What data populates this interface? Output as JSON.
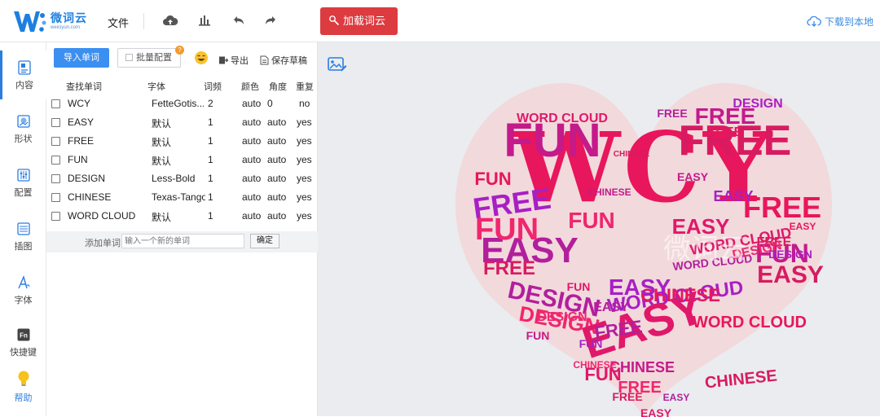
{
  "app": {
    "name": "微词云",
    "url": "weiciyun.com"
  },
  "toolbar": {
    "file_label": "文件",
    "icons": [
      "cloud-upload-icon",
      "bar-chart-icon",
      "undo-icon",
      "redo-icon"
    ],
    "load_button": "加载词云",
    "download_label": "下载到本地",
    "accent": "#dc3b40",
    "link_color": "#3b8be0"
  },
  "sidebar": {
    "items": [
      {
        "label": "内容",
        "icon": "content-icon",
        "active": true
      },
      {
        "label": "形状",
        "icon": "shape-icon"
      },
      {
        "label": "配置",
        "icon": "config-icon"
      },
      {
        "label": "插图",
        "icon": "illustration-icon"
      },
      {
        "label": "字体",
        "icon": "font-icon"
      },
      {
        "label": "快捷键",
        "icon": "shortcut-icon"
      },
      {
        "label": "帮助",
        "icon": "lightbulb-icon"
      }
    ]
  },
  "panel": {
    "import_button": "导入单词",
    "batch_button": "批量配置",
    "batch_badge": "?",
    "export_button": "导出",
    "save_button": "保存草稿",
    "columns": [
      "查找单词",
      "字体",
      "词频",
      "颜色",
      "角度",
      "重复"
    ],
    "rows": [
      {
        "word": "WCY",
        "font": "FetteGotis...",
        "freq": "2",
        "color": "auto",
        "angle": "0",
        "repeat": "no"
      },
      {
        "word": "EASY",
        "font": "默认",
        "freq": "1",
        "color": "auto",
        "angle": "auto",
        "repeat": "yes"
      },
      {
        "word": "FREE",
        "font": "默认",
        "freq": "1",
        "color": "auto",
        "angle": "auto",
        "repeat": "yes"
      },
      {
        "word": "FUN",
        "font": "默认",
        "freq": "1",
        "color": "auto",
        "angle": "auto",
        "repeat": "yes"
      },
      {
        "word": "DESIGN",
        "font": "Less-Bold",
        "freq": "1",
        "color": "auto",
        "angle": "auto",
        "repeat": "yes"
      },
      {
        "word": "CHINESE",
        "font": "Texas-Tango",
        "freq": "1",
        "color": "auto",
        "angle": "auto",
        "repeat": "yes"
      },
      {
        "word": "WORD CLOUD",
        "font": "默认",
        "freq": "1",
        "color": "auto",
        "angle": "auto",
        "repeat": "yes"
      }
    ],
    "add_label": "添加单词",
    "add_placeholder": "输入一个新的单词",
    "add_confirm": "确定"
  },
  "canvas": {
    "background": "#eaecef",
    "heart_fill": "#f2d9dc",
    "watermark": "微词云",
    "words": [
      "WCY",
      "FUN",
      "FREE",
      "EASY",
      "FUN",
      "FREE",
      "EASY",
      "FREE",
      "FUN",
      "EASY",
      "DESIGN",
      "DESIGN",
      "WORD CLOUD",
      "WORD CLOUD",
      "CHINESE",
      "CHINESE",
      "CHINESE",
      "FREE",
      "FUN",
      "EASY",
      "EASY",
      "FUN",
      "FREE",
      "FREE",
      "FREE",
      "DESIGN",
      "DESIGN",
      "WORD CLOUD",
      "WORD CLOUD",
      "CHINESE",
      "CHINESE",
      "WORD CLOUD",
      "FREE",
      "EASY",
      "FUN",
      "FREE",
      "EASY",
      "FREE",
      "EASY",
      "CHINESE",
      "DESIGN",
      "FUN",
      "EASY",
      "FUN",
      "FREE",
      "EASY",
      "DESIGN",
      "FUN",
      "EASY"
    ],
    "colors": [
      "#e8165c",
      "#c41a8a",
      "#d81b60",
      "#b21f9c",
      "#f0266e",
      "#a81fc4",
      "#e0186a"
    ]
  }
}
